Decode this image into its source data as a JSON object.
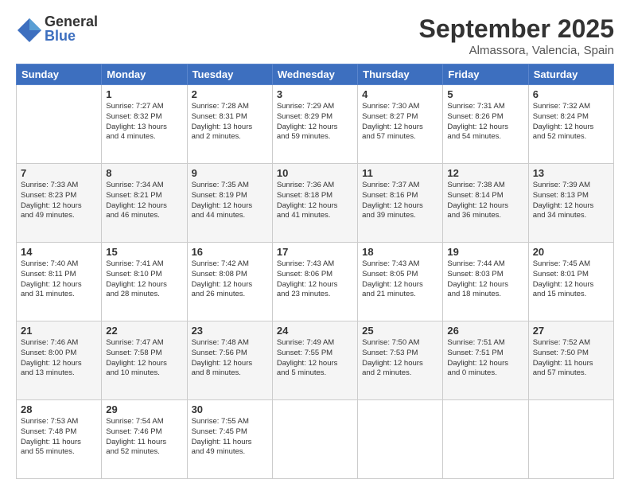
{
  "header": {
    "logo_line1": "General",
    "logo_line2": "Blue",
    "month": "September 2025",
    "location": "Almassora, Valencia, Spain"
  },
  "weekdays": [
    "Sunday",
    "Monday",
    "Tuesday",
    "Wednesday",
    "Thursday",
    "Friday",
    "Saturday"
  ],
  "weeks": [
    [
      {
        "day": "",
        "info": ""
      },
      {
        "day": "1",
        "info": "Sunrise: 7:27 AM\nSunset: 8:32 PM\nDaylight: 13 hours\nand 4 minutes."
      },
      {
        "day": "2",
        "info": "Sunrise: 7:28 AM\nSunset: 8:31 PM\nDaylight: 13 hours\nand 2 minutes."
      },
      {
        "day": "3",
        "info": "Sunrise: 7:29 AM\nSunset: 8:29 PM\nDaylight: 12 hours\nand 59 minutes."
      },
      {
        "day": "4",
        "info": "Sunrise: 7:30 AM\nSunset: 8:27 PM\nDaylight: 12 hours\nand 57 minutes."
      },
      {
        "day": "5",
        "info": "Sunrise: 7:31 AM\nSunset: 8:26 PM\nDaylight: 12 hours\nand 54 minutes."
      },
      {
        "day": "6",
        "info": "Sunrise: 7:32 AM\nSunset: 8:24 PM\nDaylight: 12 hours\nand 52 minutes."
      }
    ],
    [
      {
        "day": "7",
        "info": "Sunrise: 7:33 AM\nSunset: 8:23 PM\nDaylight: 12 hours\nand 49 minutes."
      },
      {
        "day": "8",
        "info": "Sunrise: 7:34 AM\nSunset: 8:21 PM\nDaylight: 12 hours\nand 46 minutes."
      },
      {
        "day": "9",
        "info": "Sunrise: 7:35 AM\nSunset: 8:19 PM\nDaylight: 12 hours\nand 44 minutes."
      },
      {
        "day": "10",
        "info": "Sunrise: 7:36 AM\nSunset: 8:18 PM\nDaylight: 12 hours\nand 41 minutes."
      },
      {
        "day": "11",
        "info": "Sunrise: 7:37 AM\nSunset: 8:16 PM\nDaylight: 12 hours\nand 39 minutes."
      },
      {
        "day": "12",
        "info": "Sunrise: 7:38 AM\nSunset: 8:14 PM\nDaylight: 12 hours\nand 36 minutes."
      },
      {
        "day": "13",
        "info": "Sunrise: 7:39 AM\nSunset: 8:13 PM\nDaylight: 12 hours\nand 34 minutes."
      }
    ],
    [
      {
        "day": "14",
        "info": "Sunrise: 7:40 AM\nSunset: 8:11 PM\nDaylight: 12 hours\nand 31 minutes."
      },
      {
        "day": "15",
        "info": "Sunrise: 7:41 AM\nSunset: 8:10 PM\nDaylight: 12 hours\nand 28 minutes."
      },
      {
        "day": "16",
        "info": "Sunrise: 7:42 AM\nSunset: 8:08 PM\nDaylight: 12 hours\nand 26 minutes."
      },
      {
        "day": "17",
        "info": "Sunrise: 7:43 AM\nSunset: 8:06 PM\nDaylight: 12 hours\nand 23 minutes."
      },
      {
        "day": "18",
        "info": "Sunrise: 7:43 AM\nSunset: 8:05 PM\nDaylight: 12 hours\nand 21 minutes."
      },
      {
        "day": "19",
        "info": "Sunrise: 7:44 AM\nSunset: 8:03 PM\nDaylight: 12 hours\nand 18 minutes."
      },
      {
        "day": "20",
        "info": "Sunrise: 7:45 AM\nSunset: 8:01 PM\nDaylight: 12 hours\nand 15 minutes."
      }
    ],
    [
      {
        "day": "21",
        "info": "Sunrise: 7:46 AM\nSunset: 8:00 PM\nDaylight: 12 hours\nand 13 minutes."
      },
      {
        "day": "22",
        "info": "Sunrise: 7:47 AM\nSunset: 7:58 PM\nDaylight: 12 hours\nand 10 minutes."
      },
      {
        "day": "23",
        "info": "Sunrise: 7:48 AM\nSunset: 7:56 PM\nDaylight: 12 hours\nand 8 minutes."
      },
      {
        "day": "24",
        "info": "Sunrise: 7:49 AM\nSunset: 7:55 PM\nDaylight: 12 hours\nand 5 minutes."
      },
      {
        "day": "25",
        "info": "Sunrise: 7:50 AM\nSunset: 7:53 PM\nDaylight: 12 hours\nand 2 minutes."
      },
      {
        "day": "26",
        "info": "Sunrise: 7:51 AM\nSunset: 7:51 PM\nDaylight: 12 hours\nand 0 minutes."
      },
      {
        "day": "27",
        "info": "Sunrise: 7:52 AM\nSunset: 7:50 PM\nDaylight: 11 hours\nand 57 minutes."
      }
    ],
    [
      {
        "day": "28",
        "info": "Sunrise: 7:53 AM\nSunset: 7:48 PM\nDaylight: 11 hours\nand 55 minutes."
      },
      {
        "day": "29",
        "info": "Sunrise: 7:54 AM\nSunset: 7:46 PM\nDaylight: 11 hours\nand 52 minutes."
      },
      {
        "day": "30",
        "info": "Sunrise: 7:55 AM\nSunset: 7:45 PM\nDaylight: 11 hours\nand 49 minutes."
      },
      {
        "day": "",
        "info": ""
      },
      {
        "day": "",
        "info": ""
      },
      {
        "day": "",
        "info": ""
      },
      {
        "day": "",
        "info": ""
      }
    ]
  ]
}
